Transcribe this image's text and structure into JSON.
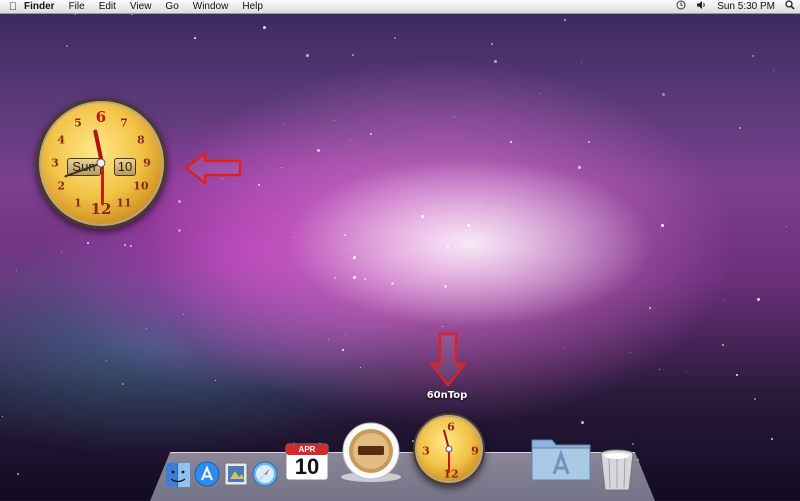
{
  "menubar": {
    "apple_icon": "apple-icon",
    "app_name": "Finder",
    "menus": [
      "File",
      "Edit",
      "View",
      "Go",
      "Window",
      "Help"
    ],
    "status": {
      "time_machine_icon": "clock-icon",
      "volume_icon": "speaker-icon",
      "clock": "Sun 5:30 PM",
      "spotlight_icon": "search-icon"
    }
  },
  "widget": {
    "day": "Sun",
    "date": "10",
    "numbers": [
      "6",
      "7",
      "8",
      "9",
      "10",
      "11",
      "12",
      "1",
      "2",
      "3",
      "4",
      "5"
    ]
  },
  "dock": {
    "calendar_month": "APR",
    "calendar_day": "10",
    "hover_label": "60nTop",
    "mini_clock_numbers": [
      "6",
      "9",
      "12",
      "3"
    ],
    "items": [
      "Finder",
      "App Store",
      "Preview",
      "Safari",
      "iCal",
      "Coffee",
      "60nTop",
      "Applications",
      "Trash"
    ]
  },
  "colors": {
    "arrow": "#e02020",
    "clock_face": "#f2c347"
  }
}
